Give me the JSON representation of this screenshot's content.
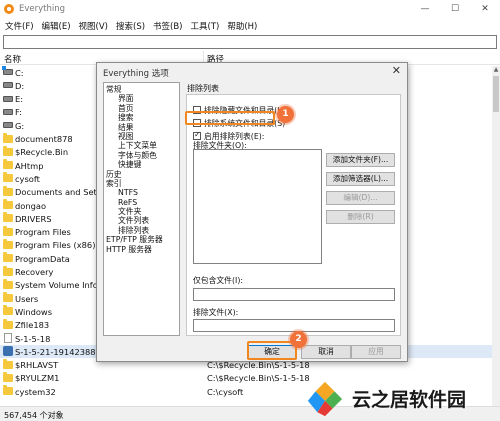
{
  "window": {
    "title": "Everything",
    "minimize": "—",
    "maximize": "☐",
    "close": "✕"
  },
  "menu": [
    "文件(F)",
    "编辑(E)",
    "视图(V)",
    "搜索(S)",
    "书签(B)",
    "工具(T)",
    "帮助(H)"
  ],
  "search": {
    "value": "",
    "placeholder": ""
  },
  "columns": {
    "name": "名称",
    "path": "路径"
  },
  "files": [
    {
      "name": "C:",
      "path": "",
      "icon": "system-drive"
    },
    {
      "name": "D:",
      "path": "",
      "icon": "drive"
    },
    {
      "name": "E:",
      "path": "",
      "icon": "drive"
    },
    {
      "name": "F:",
      "path": "",
      "icon": "drive"
    },
    {
      "name": "G:",
      "path": "",
      "icon": "drive"
    },
    {
      "name": "document878",
      "path": "",
      "icon": "folder"
    },
    {
      "name": "$Recycle.Bin",
      "path": "",
      "icon": "folder"
    },
    {
      "name": "AHtmp",
      "path": "",
      "icon": "folder"
    },
    {
      "name": "cysoft",
      "path": "",
      "icon": "folder"
    },
    {
      "name": "Documents and Settin",
      "path": "",
      "icon": "folder"
    },
    {
      "name": "dongao",
      "path": "",
      "icon": "folder"
    },
    {
      "name": "DRIVERS",
      "path": "",
      "icon": "folder"
    },
    {
      "name": "Program Files",
      "path": "",
      "icon": "folder"
    },
    {
      "name": "Program Files (x86)",
      "path": "",
      "icon": "folder"
    },
    {
      "name": "ProgramData",
      "path": "",
      "icon": "folder"
    },
    {
      "name": "Recovery",
      "path": "",
      "icon": "folder"
    },
    {
      "name": "System Volume Inforn",
      "path": "",
      "icon": "folder"
    },
    {
      "name": "Users",
      "path": "",
      "icon": "folder"
    },
    {
      "name": "Windows",
      "path": "",
      "icon": "folder"
    },
    {
      "name": "Zfile183",
      "path": "",
      "icon": "folder"
    },
    {
      "name": "S-1-5-18",
      "path": "",
      "icon": "file"
    },
    {
      "name": "S-1-5-21-1914238884",
      "path": "",
      "icon": "sid",
      "selected": true
    },
    {
      "name": "$RHLAVST",
      "path": "C:\\$Recycle.Bin\\S-1-5-18",
      "icon": "folder"
    },
    {
      "name": "$RYULZM1",
      "path": "C:\\$Recycle.Bin\\S-1-5-18",
      "icon": "folder"
    },
    {
      "name": "cystem32",
      "path": "C:\\cysoft",
      "icon": "folder"
    }
  ],
  "status": "567,454 个对象",
  "dialog": {
    "title": "Everything 选项",
    "close": "✕",
    "tree": [
      {
        "label": "常规",
        "level": 0
      },
      {
        "label": "界面",
        "level": 1
      },
      {
        "label": "首页",
        "level": 1
      },
      {
        "label": "搜索",
        "level": 1
      },
      {
        "label": "结果",
        "level": 1
      },
      {
        "label": "视图",
        "level": 1
      },
      {
        "label": "上下文菜单",
        "level": 1
      },
      {
        "label": "字体与颜色",
        "level": 1
      },
      {
        "label": "快捷键",
        "level": 1
      },
      {
        "label": "历史",
        "level": 0
      },
      {
        "label": "索引",
        "level": 0
      },
      {
        "label": "NTFS",
        "level": 1
      },
      {
        "label": "ReFS",
        "level": 1
      },
      {
        "label": "文件夹",
        "level": 1
      },
      {
        "label": "文件列表",
        "level": 1
      },
      {
        "label": "排除列表",
        "level": 1
      },
      {
        "label": "ETP/FTP 服务器",
        "level": 0
      },
      {
        "label": "HTTP 服务器",
        "level": 0
      }
    ],
    "panel_title": "排除列表",
    "checks": [
      {
        "label": "排除隐藏文件和目录(H)",
        "checked": false
      },
      {
        "label": "排除系统文件和目录(S)",
        "checked": false
      },
      {
        "label": "启用排除列表(E):",
        "checked": true
      }
    ],
    "exclude_folders_label": "排除文件夹(O):",
    "side_buttons": {
      "add_folder": "添加文件夹(F)...",
      "add_filter": "添加筛选器(L)...",
      "edit": "编辑(D)...",
      "remove": "删除(R)"
    },
    "include_files_label": "仅包含文件(I):",
    "exclude_files_label": "排除文件(X):",
    "ok": "确定",
    "cancel": "取消",
    "apply": "应用"
  },
  "annotations": {
    "step1": "1",
    "step2": "2"
  },
  "watermark": {
    "text": "云之居软件园"
  },
  "colors": {
    "highlight": "#f2871f",
    "badge": "#f0713a",
    "folder": "#f5c93b",
    "accent": "#0078d7"
  }
}
